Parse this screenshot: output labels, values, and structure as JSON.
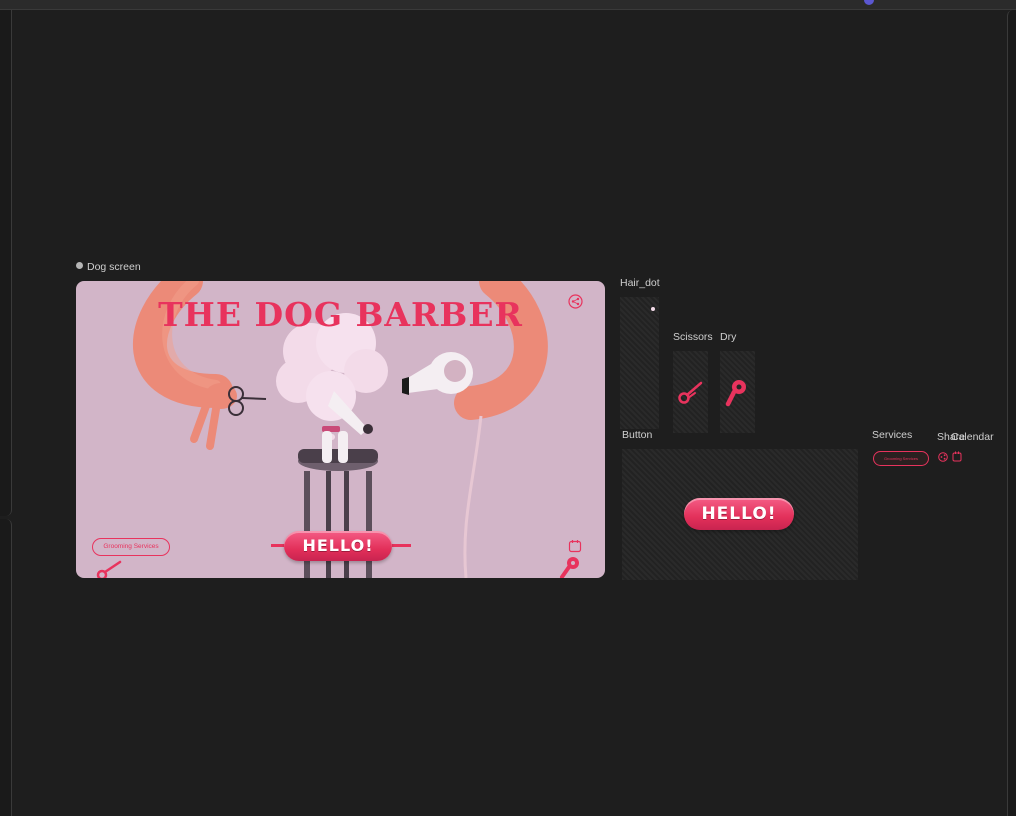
{
  "frames": {
    "dog_screen": "Dog screen",
    "hair_dot": "Hair_dot",
    "scissors": "Scissors",
    "dry": "Dry",
    "button": "Button",
    "services": "Services",
    "share": "Share",
    "calendar": "Calendar"
  },
  "dog_screen": {
    "title": "The Dog Barber",
    "services_label": "Grooming Services",
    "hello_label": "HELLO!"
  },
  "button_frame": {
    "hello_label": "HELLO!"
  },
  "services_frame": {
    "label": "Grooming Services"
  },
  "icons": {
    "share": "share-icon",
    "calendar": "calendar-icon",
    "scissors": "scissors-icon",
    "dryer": "hair-dryer-icon"
  },
  "colors": {
    "accent": "#e8335d",
    "screen_bg": "#d2b5c8",
    "canvas": "#1e1e1e"
  }
}
